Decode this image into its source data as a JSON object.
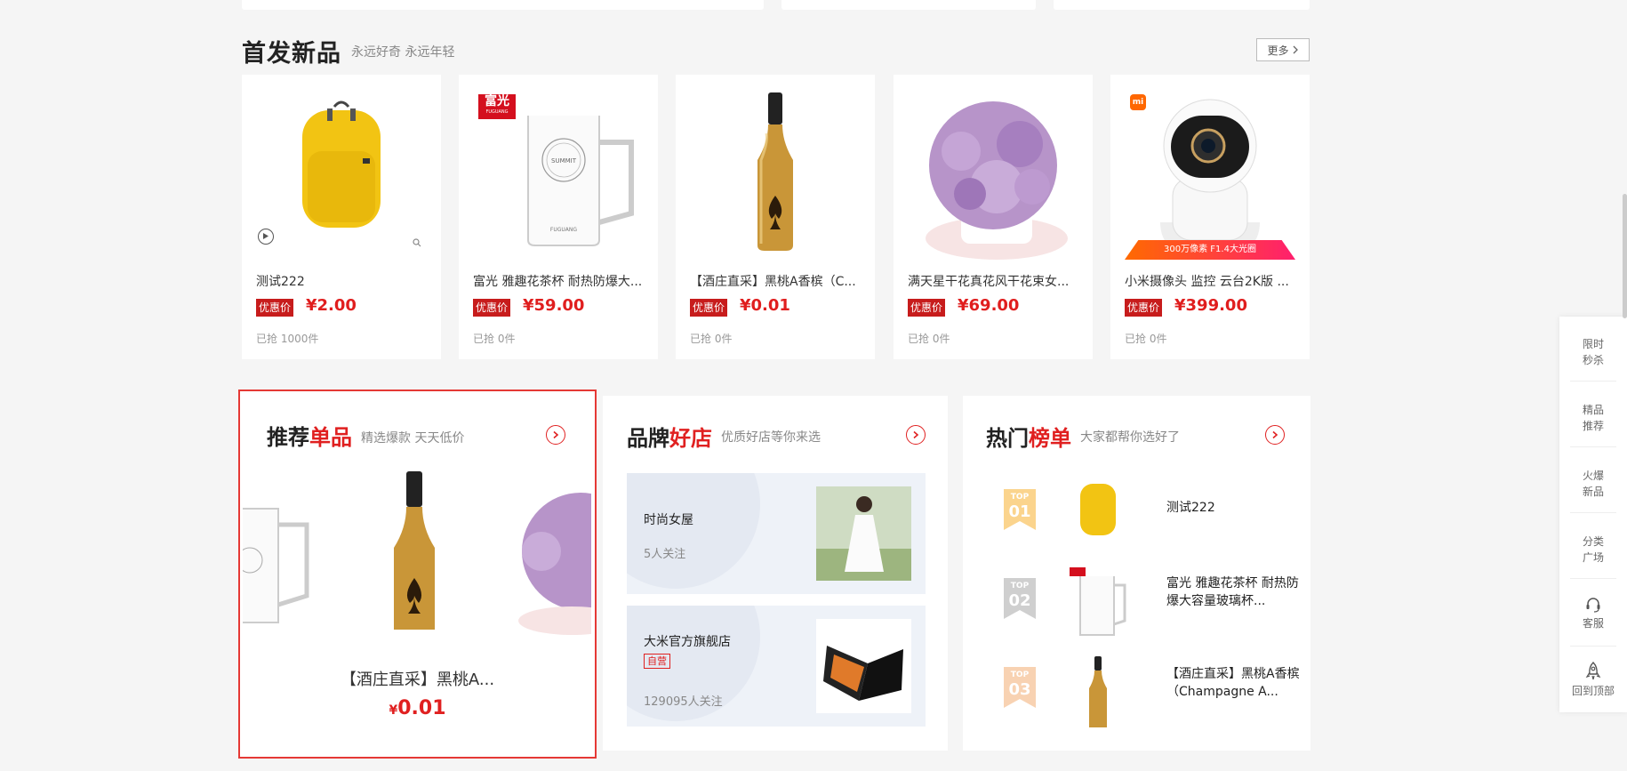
{
  "section_new": {
    "title": "首发新品",
    "subtitle": "永远好奇 永远年轻",
    "more_label": "更多"
  },
  "products": [
    {
      "name": "测试222",
      "badge": "优惠价",
      "price": "¥2.00",
      "sold": "已抢 1000件"
    },
    {
      "name": "富光 雅趣花茶杯 耐热防爆大...",
      "badge": "优惠价",
      "price": "¥59.00",
      "sold": "已抢 0件",
      "brand_tag": "富光",
      "brand_sub": "FUGUANG",
      "mug_text": "SUMMIT"
    },
    {
      "name": "【酒庄直采】黑桃A香槟（C...",
      "badge": "优惠价",
      "price": "¥0.01",
      "sold": "已抢 0件"
    },
    {
      "name": "满天星干花真花风干花束女...",
      "badge": "优惠价",
      "price": "¥69.00",
      "sold": "已抢 0件"
    },
    {
      "name": "小米摄像头 监控 云台2K版 ...",
      "badge": "优惠价",
      "price": "¥399.00",
      "sold": "已抢 0件",
      "brand_tag": "mi",
      "banner_text": "300万像素  F1.4大光圈"
    }
  ],
  "recommend": {
    "title_a": "推荐",
    "title_b": "单品",
    "subtitle": "精选爆款 天天低价",
    "item_name": "【酒庄直采】黑桃A...",
    "currency": "¥",
    "item_price": "0.01"
  },
  "brand_shops": {
    "title_a": "品牌",
    "title_b": "好店",
    "subtitle": "优质好店等你来选",
    "shops": [
      {
        "name": "时尚女屋",
        "followers": "5人关注"
      },
      {
        "name": "大米官方旗舰店",
        "tag": "自营",
        "followers": "129095人关注"
      }
    ]
  },
  "hot_rank": {
    "title_a": "热门",
    "title_b": "榜单",
    "subtitle": "大家都帮你选好了",
    "items": [
      {
        "top_label": "TOP",
        "rank": "01",
        "name": "测试222"
      },
      {
        "top_label": "TOP",
        "rank": "02",
        "name": "富光 雅趣花茶杯 耐热防爆大容量玻璃杯..."
      },
      {
        "top_label": "TOP",
        "rank": "03",
        "name": "【酒庄直采】黑桃A香槟（Champagne A..."
      }
    ]
  },
  "sidebar": {
    "items": [
      {
        "line1": "限时",
        "line2": "秒杀"
      },
      {
        "line1": "精品",
        "line2": "推荐"
      },
      {
        "line1": "火爆",
        "line2": "新品"
      },
      {
        "line1": "分类",
        "line2": "广场"
      },
      {
        "label": "客服"
      },
      {
        "label": "回到顶部"
      }
    ]
  },
  "colors": {
    "accent_red": "#e02020",
    "badge_red": "#c71c1c",
    "highlight_border": "#e53935"
  }
}
